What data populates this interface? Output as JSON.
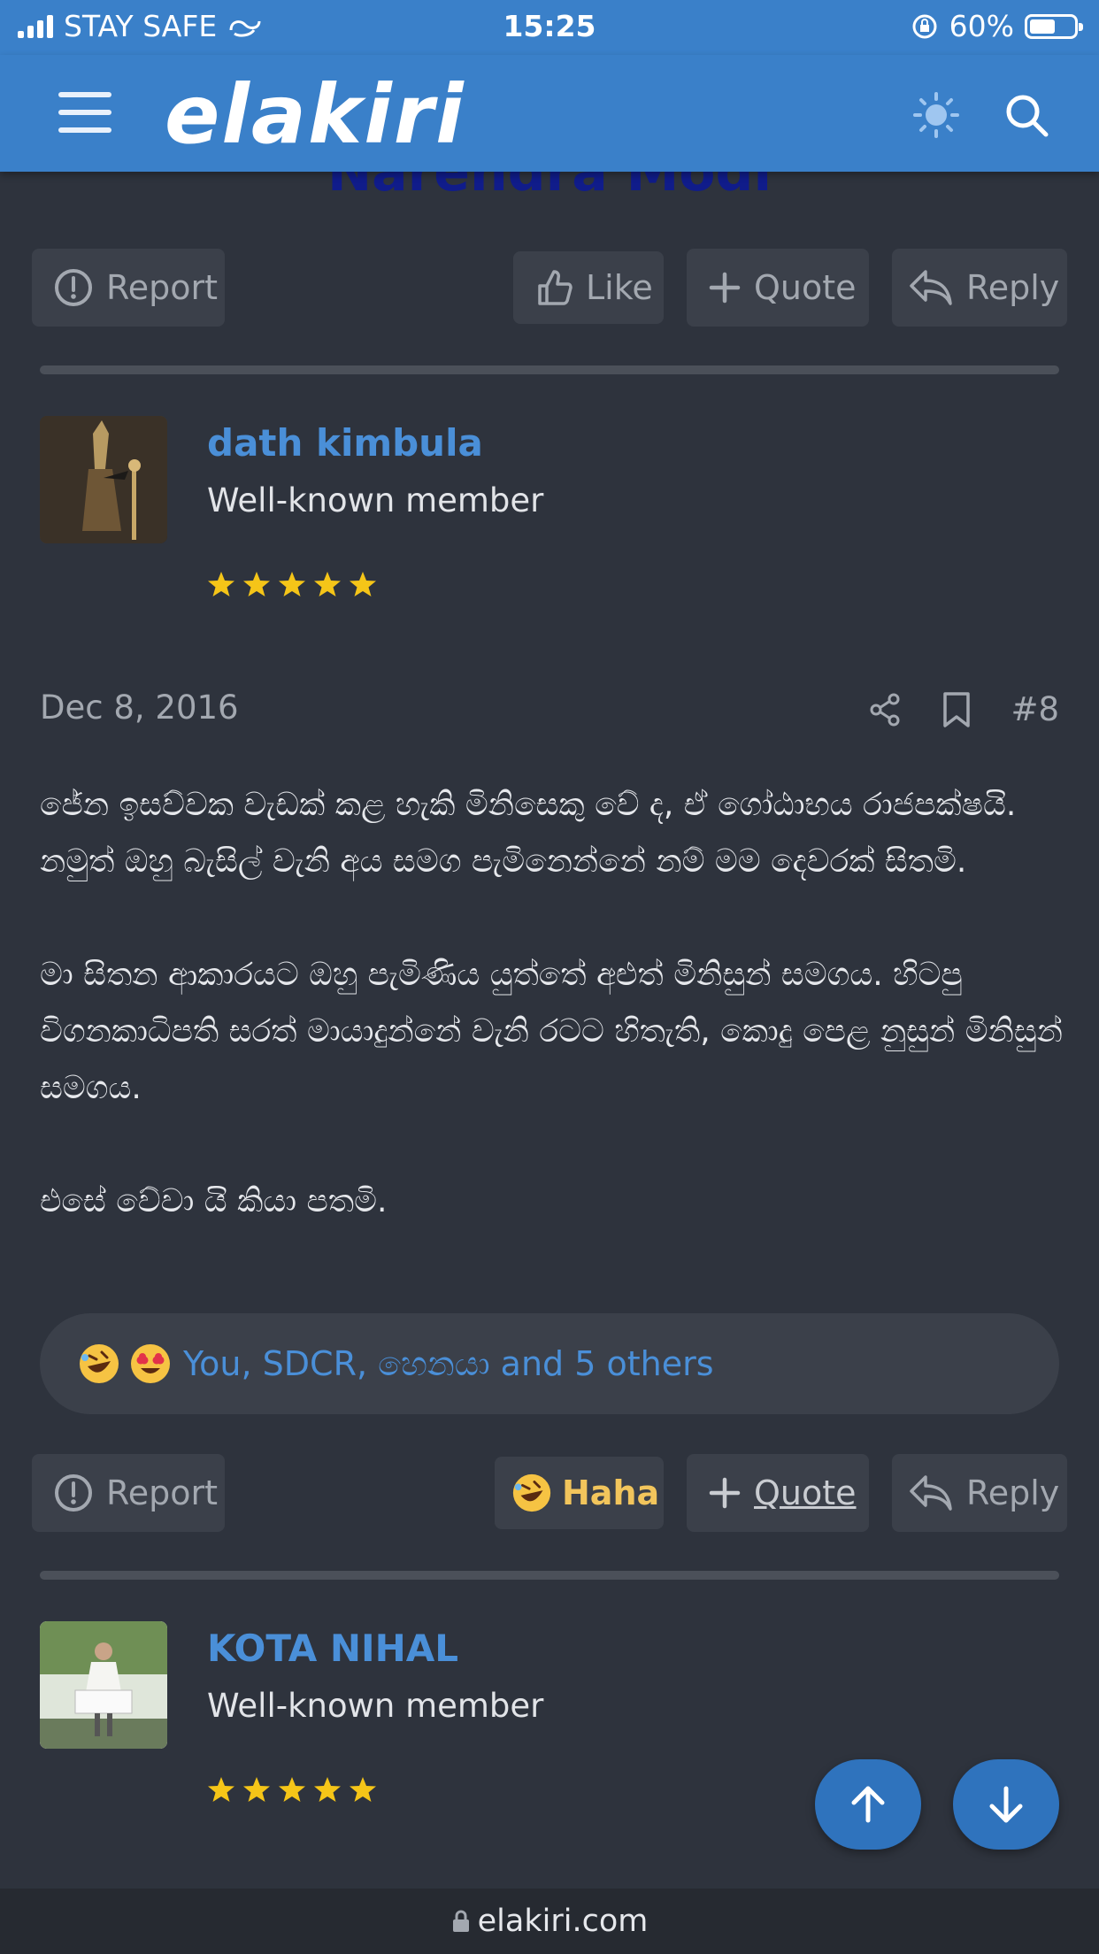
{
  "status_bar": {
    "carrier": "STAY SAFE",
    "time": "15:25",
    "battery": "60%",
    "battery_level": 0.6
  },
  "header": {
    "logo": "elakiri"
  },
  "top_partial_text": "Narendra Modi",
  "post_actions_top": {
    "report": "Report",
    "like": "Like",
    "quote": "Quote",
    "reply": "Reply"
  },
  "post": {
    "username": "dath kimbula",
    "user_title": "Well-known member",
    "stars": 5,
    "date": "Dec 8, 2016",
    "post_number": "#8",
    "paragraphs": [
      "ජේන ඉසව්වක වැඩක් කළ හැකි මිනිසෙකු වේ ද, ඒ ගෝඨාභය රාජපක්ෂයි. නමුත් ඔහු බැසිල් වැනි අය සමග පැමිනෙන්නේ නම් මම දෙවරක් සිතමි.",
      "මා සිතන ආකාරයට ඔහු පැමිණිය යුත්තේ අළුත් මිනිසුන් සමගය. හිටපු විගනකාධිපති සරත් මායාදුන්නේ වැනි රටට හිතැති, කොදු පෙළ නුසුන් මිනිසුන් සමගය.",
      "එසේ වේවා යි කියා පතමි."
    ],
    "reactions_text": "You, SDCR, හෙනයා and 5 others"
  },
  "post_actions_bottom": {
    "report": "Report",
    "reaction": "Haha",
    "quote": "Quote",
    "reply": "Reply"
  },
  "next_post": {
    "username": "KOTA NIHAL",
    "user_title": "Well-known member",
    "stars": 5
  },
  "bottom_bar": {
    "url": "elakiri.com"
  },
  "colors": {
    "header_bg": "#3a80c9",
    "page_bg": "#2e333d",
    "username": "#4a8fd8",
    "star": "#f5c518",
    "haha": "#f2c55c"
  }
}
